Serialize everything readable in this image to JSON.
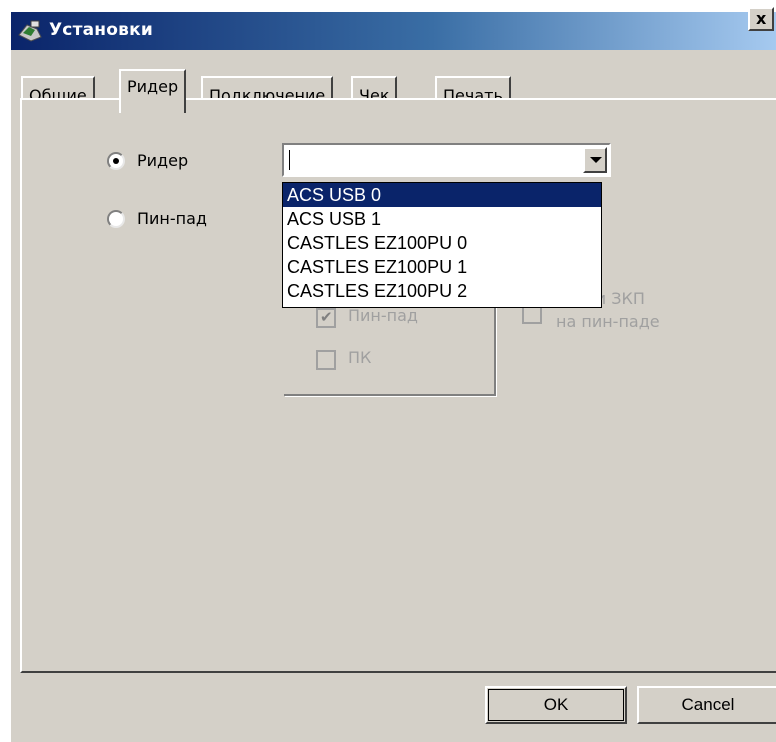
{
  "window": {
    "title": "Установки",
    "close_label": "x"
  },
  "tabs": [
    {
      "label": "Общие"
    },
    {
      "label": "Ридер",
      "active": true
    },
    {
      "label": "Подключение"
    },
    {
      "label": "Чек"
    },
    {
      "label": "Печать"
    }
  ],
  "source": {
    "reader_label": "Ридер",
    "reader_selected": true,
    "pinpad_label": "Пин-пад",
    "pinpad_selected": false
  },
  "reader_combo": {
    "value": "",
    "options": [
      "ACS USB 0",
      "ACS USB 1",
      "CASTLES EZ100PU 0",
      "CASTLES EZ100PU 1",
      "CASTLES EZ100PU 2"
    ],
    "highlighted": "ACS USB 0"
  },
  "input_group": {
    "pinpad_option": "Пин-пад",
    "pinpad_checked": true,
    "pc_option": "ПК",
    "pc_checked": false
  },
  "pinpad_display": {
    "line1": "мы и ЗКП",
    "line2": "на пин-паде"
  },
  "buttons": {
    "ok": "OK",
    "cancel": "Cancel"
  }
}
